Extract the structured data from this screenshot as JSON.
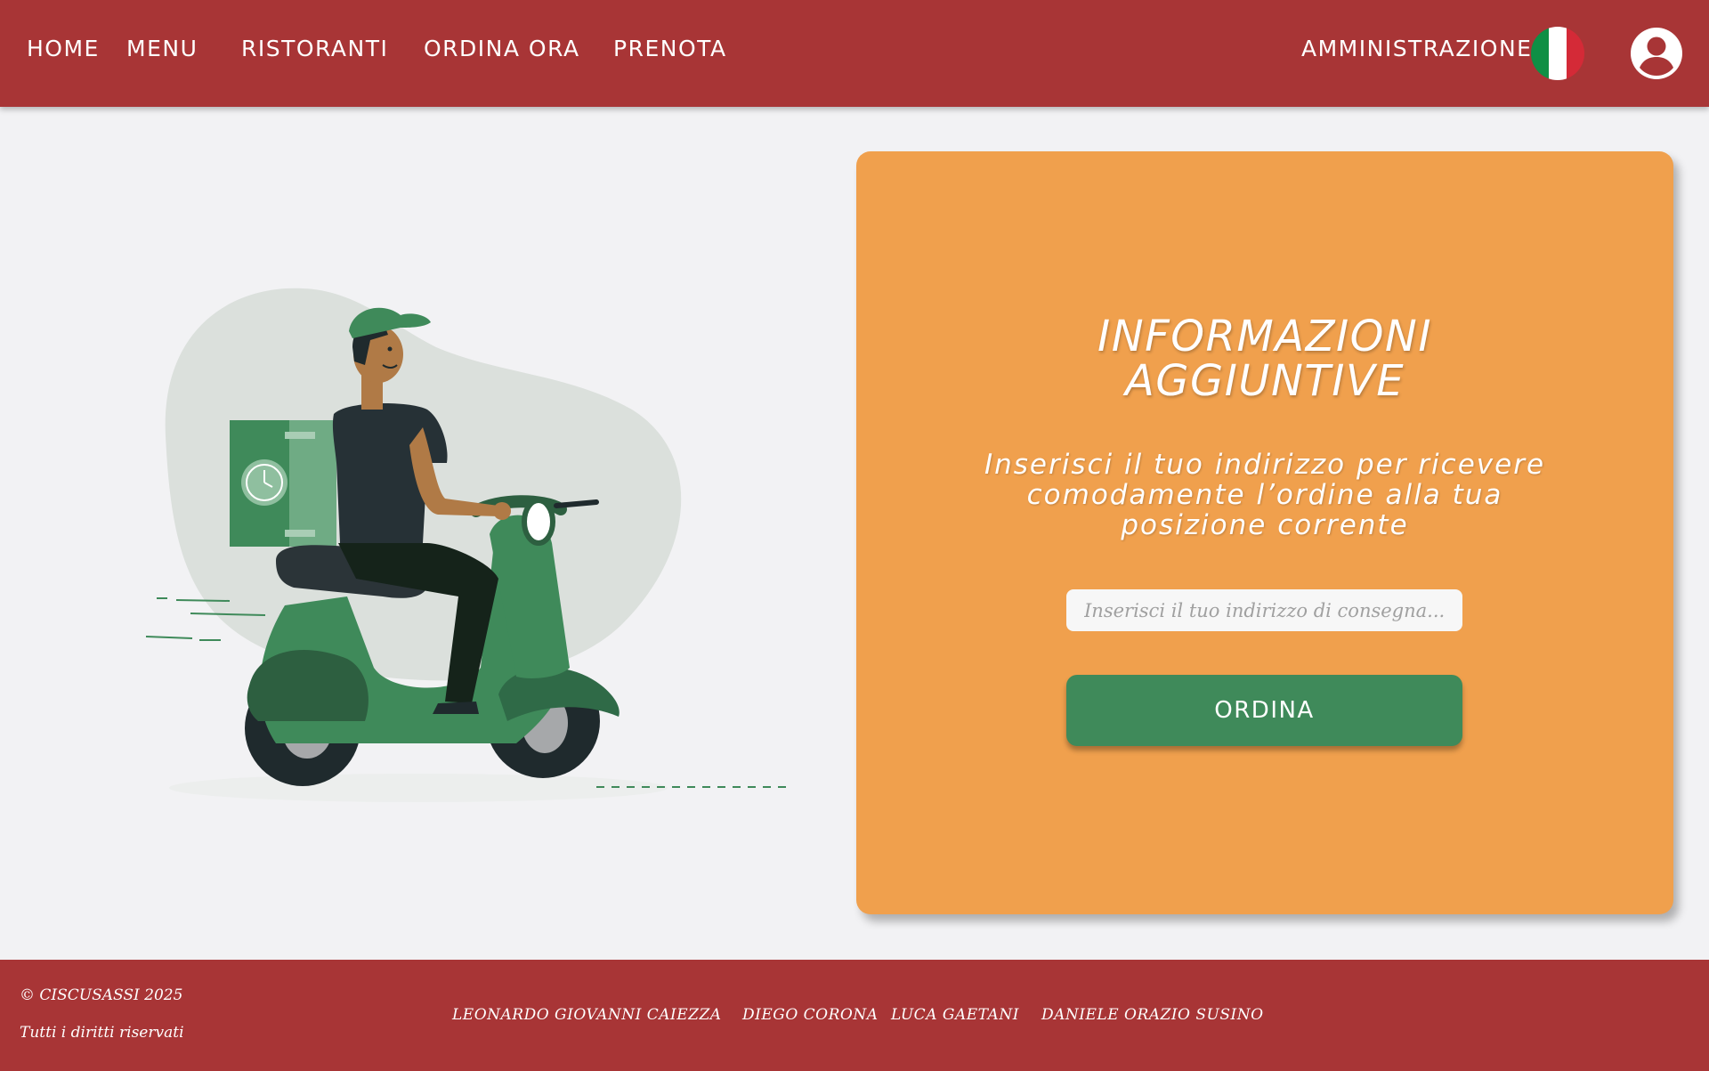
{
  "nav": {
    "home": "HOME",
    "menu": "MENU",
    "ristoranti": "RISTORANTI",
    "ordina_ora": "ORDINA ORA",
    "prenota": "PRENOTA",
    "amministrazione": "AMMINISTRAZIONE",
    "flag_colors": [
      "#0f8f45",
      "#ffffff",
      "#d42a37"
    ],
    "user_icon": "user-circle-icon"
  },
  "card": {
    "title_line1": "INFORMAZIONI",
    "title_line2": "AGGIUNTIVE",
    "subtitle": "Inserisci il tuo indirizzo per ricevere comodamente l’ordine alla tua posizione corrente",
    "input_placeholder": "Inserisci il tuo indirizzo di consegna...",
    "input_value": "",
    "button_label": "ORDINA"
  },
  "footer": {
    "copyright": "© CISCUSASSI 2025",
    "rights": "Tutti i diritti riservati",
    "authors": [
      "LEONARDO GIOVANNI CAIEZZA",
      "DIEGO CORONA",
      "LUCA GAETANI",
      "DANIELE ORAZIO SUSINO"
    ]
  },
  "colors": {
    "primary_red": "#a83536",
    "card_orange": "#f0a04d",
    "button_green": "#3f8a5a",
    "background": "#f2f2f4"
  }
}
